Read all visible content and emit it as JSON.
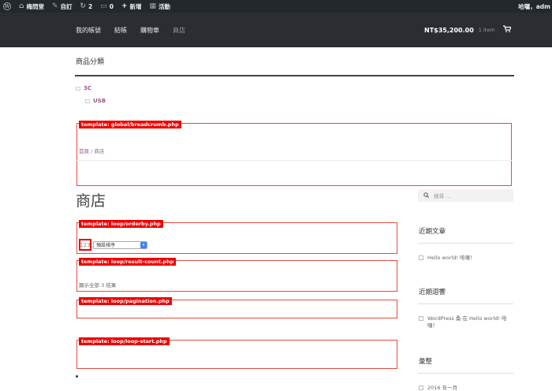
{
  "adminbar": {
    "site_name": "梅問堂",
    "customize": "自訂",
    "updates": "2",
    "comments": "0",
    "new": "新增",
    "events": "活動",
    "greeting": "哈囉，adm"
  },
  "nav": {
    "items": [
      "我的帳號",
      "結帳",
      "購物車",
      "商店"
    ]
  },
  "cart": {
    "amount": "NT$35,200.00",
    "count": "1 item"
  },
  "categories": {
    "title": "商品分類",
    "items": [
      "3C",
      "USB"
    ]
  },
  "templates": {
    "breadcrumb": "template: global/breadcrumb.php",
    "orderby": "template: loop/orderby.php",
    "result_count": "template: loop/result-count.php",
    "pagination": "template: loop/pagination.php",
    "loop_start": "template: loop/loop-start.php"
  },
  "breadcrumb": {
    "home": "首頁",
    "separator": " / ",
    "current": "商店"
  },
  "page_title": "商店",
  "sorting": {
    "page_value": "123",
    "selected": "預設排序"
  },
  "result_count": "顯示全部 3 結果",
  "sidebar": {
    "search_placeholder": "搜尋 ...",
    "recent_posts_title": "近期文章",
    "recent_posts": [
      "Hello world! 哈囉！"
    ],
    "recent_comments_title": "近期迴響",
    "recent_comment": "WordPress 桑 在 Hello world! 哈囉！",
    "archives_title": "彙整",
    "archive_item": "2016 年一月"
  },
  "colors": {
    "accent": "#96588a",
    "template_red": "#e00000",
    "header_bg": "#2c2d33",
    "adminbar_bg": "#23282d"
  }
}
